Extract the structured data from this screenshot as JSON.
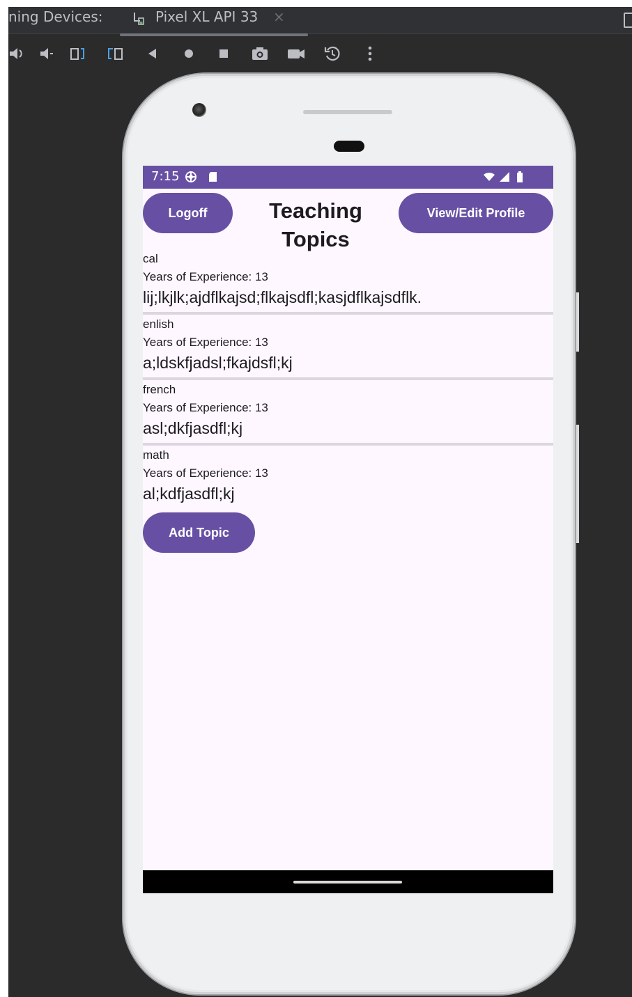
{
  "ide": {
    "tab_label": "ning Devices:",
    "device_tab": "Pixel XL API 33",
    "device_tab_close": "×"
  },
  "toolbar_icons": [
    "volume-up-icon",
    "volume-down-icon",
    "rotate-left-icon",
    "rotate-right-icon",
    "back-icon",
    "home-icon",
    "overview-icon",
    "camera-icon",
    "video-icon",
    "snapshot-icon",
    "more-icon"
  ],
  "status_bar": {
    "time": "7:15"
  },
  "app": {
    "logoff_label": "Logoff",
    "title": "Teaching Topics",
    "profile_label": "View/Edit Profile",
    "add_topic_label": "Add Topic",
    "topics": [
      {
        "name": "cal",
        "years": "Years of Experience: 13",
        "description": "lij;lkjlk;ajdflkajsd;flkajsdfl;kasjdflkajsdflk."
      },
      {
        "name": "enlish",
        "years": "Years of Experience: 13",
        "description": "a;ldskfjadsl;fkajdsfl;kj"
      },
      {
        "name": "french",
        "years": "Years of Experience: 13",
        "description": "asl;dkfjasdfl;kj"
      },
      {
        "name": "math",
        "years": "Years of Experience: 13",
        "description": "al;kdfjasdfl;kj"
      }
    ]
  },
  "colors": {
    "primary": "#6750a4",
    "screen_bg": "#fef7ff",
    "ide_bg": "#2b2b2b"
  }
}
